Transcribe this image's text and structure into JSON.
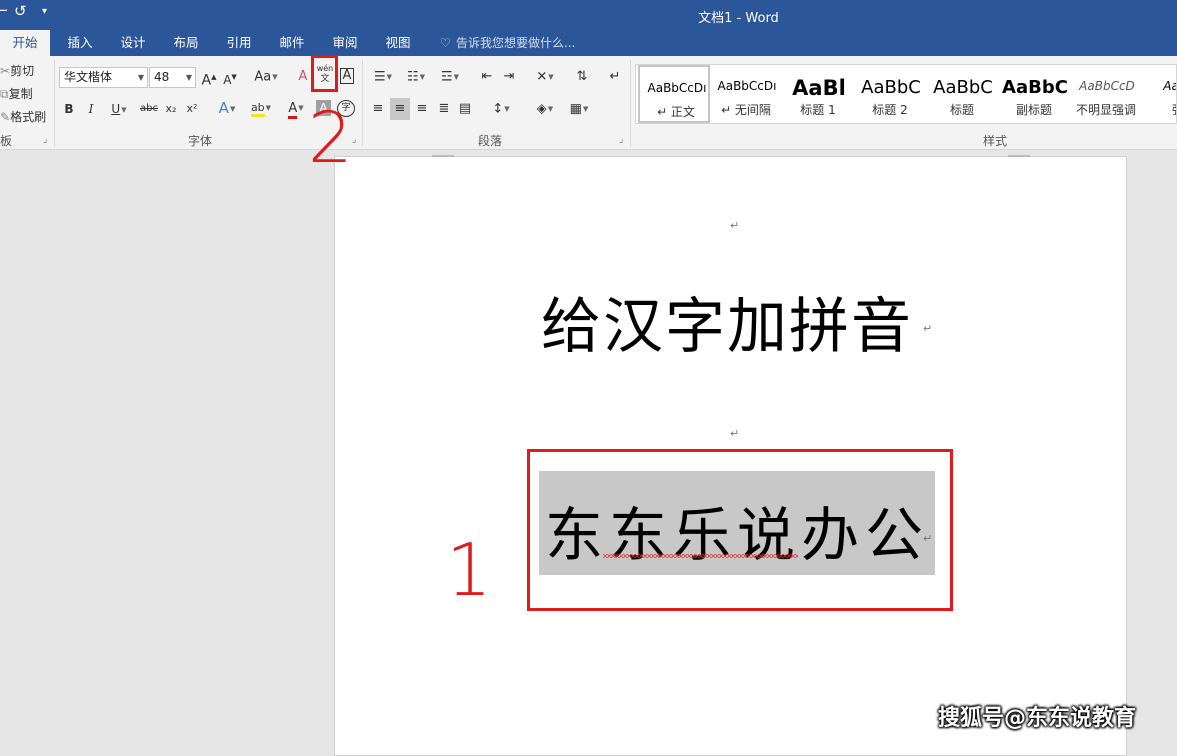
{
  "window": {
    "title": "文档1 - Word"
  },
  "quick_access": {
    "undo_glyph": "⌐",
    "redo_glyph": "↺",
    "customize_glyph": "⩧"
  },
  "tabs": [
    {
      "label": "开始",
      "active": true
    },
    {
      "label": "插入"
    },
    {
      "label": "设计"
    },
    {
      "label": "布局"
    },
    {
      "label": "引用"
    },
    {
      "label": "邮件"
    },
    {
      "label": "审阅"
    },
    {
      "label": "视图"
    }
  ],
  "tell_me": {
    "placeholder": "告诉我您想要做什么..."
  },
  "clipboard": {
    "cut": "剪切",
    "copy": "复制",
    "format_painter": "格式刷",
    "group_label": "板"
  },
  "font": {
    "name": "华文楷体",
    "size": "48",
    "group_label": "字体",
    "grow_icon": "A",
    "shrink_icon": "A",
    "case_icon": "Aa",
    "clear_icon": "A",
    "phonetic_top": "wén",
    "phonetic_bottom": "文",
    "border_icon": "A",
    "bold": "B",
    "italic": "I",
    "underline": "U",
    "strike": "abc",
    "subscript": "x₂",
    "superscript": "x²",
    "effects": "A",
    "highlight": "ab",
    "font_color": "A",
    "shading": "A",
    "enclose": "字"
  },
  "paragraph": {
    "group_label": "段落"
  },
  "styles": {
    "group_label": "样式",
    "items": [
      {
        "preview": "AaBbCcDı",
        "name": "↵ 正文"
      },
      {
        "preview": "AaBbCcDı",
        "name": "↵ 无间隔"
      },
      {
        "preview": "AaBl",
        "name": "标题 1"
      },
      {
        "preview": "AaBbC",
        "name": "标题 2"
      },
      {
        "preview": "AaBbC",
        "name": "标题"
      },
      {
        "preview": "AaBbC",
        "name": "副标题"
      },
      {
        "preview": "AaBbCcD",
        "name": "不明显强调"
      },
      {
        "preview": "AaBb",
        "name": "强"
      }
    ]
  },
  "document": {
    "para_mark": "↵",
    "heading": "给汉字加拼音",
    "selected_text": "东东乐说办公"
  },
  "annotations": {
    "step1": "1",
    "step2": "2"
  },
  "watermark": "搜狐号@东东说教育",
  "colors": {
    "word_blue": "#2b579a",
    "annotation_red": "#e01b1b",
    "selection_gray": "#c8c8c8"
  }
}
